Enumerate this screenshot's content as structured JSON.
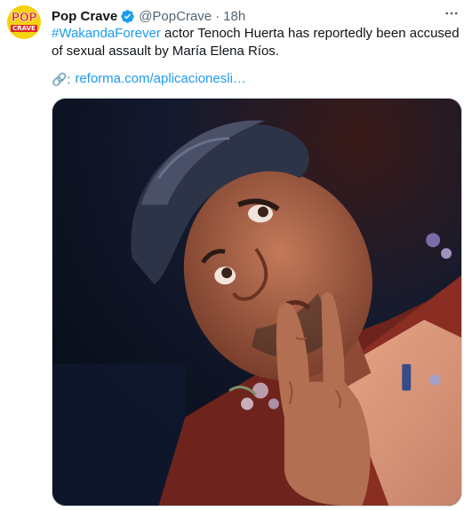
{
  "tweet": {
    "author": {
      "name": "Pop Crave",
      "handle": "@PopCrave",
      "avatar_text_top": "POP",
      "avatar_text_bottom": "CRAVE",
      "verified_icon": "verified-badge-icon"
    },
    "separator": "·",
    "time": "18h",
    "more_icon": "more-horizontal-icon",
    "hashtag": "#WakandaForever",
    "body_text": " actor Tenoch Huerta has reportedly been accused of sexual assault by María Elena Ríos.",
    "link_prefix_icon": "link-emoji-icon",
    "link_prefix": "🔗:",
    "link_text": "reforma.com/aplicacionesli…",
    "media_description_icon": "photo-portrait-image"
  },
  "colors": {
    "accent": "#1d9bf0",
    "text": "#0f1419",
    "secondary": "#536471",
    "avatar_bg": "#f5d20f",
    "avatar_red": "#e02424"
  }
}
